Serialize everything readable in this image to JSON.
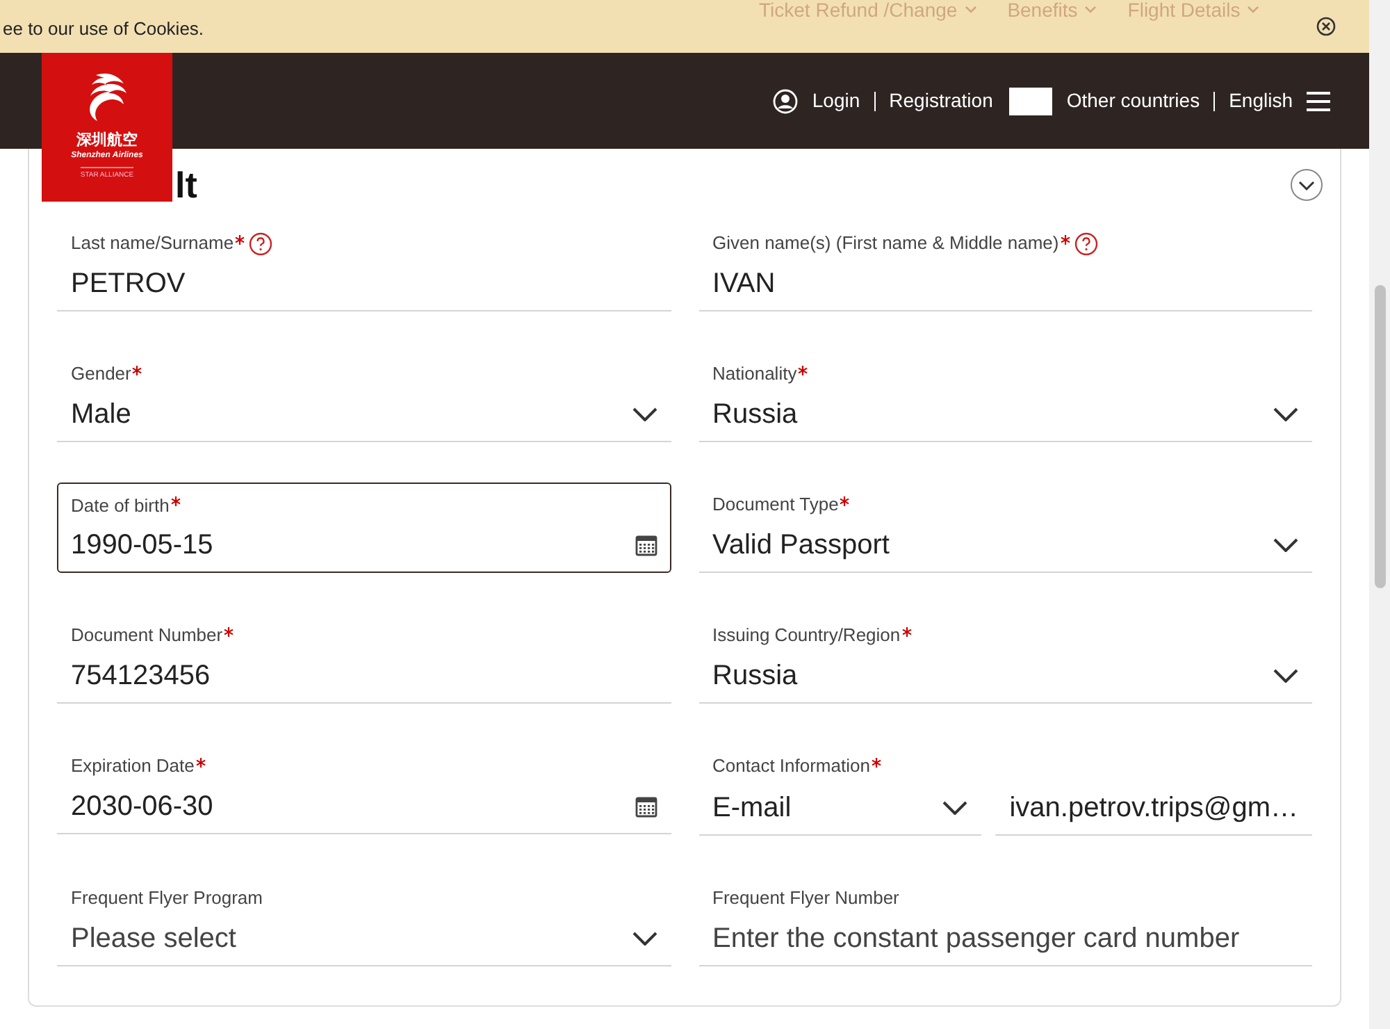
{
  "cookie_bar": {
    "text": "ee to our use of Cookies.",
    "nav": [
      "Ticket Refund /Change",
      "Benefits",
      "Flight Details"
    ]
  },
  "header": {
    "logo": {
      "chinese": "深圳航空",
      "english": "Shenzhen Airlines",
      "alliance": "STAR ALLIANCE"
    },
    "login": "Login",
    "registration": "Registration",
    "country": "Other countries",
    "language": "English"
  },
  "section": {
    "title": "lt",
    "expanded": false
  },
  "fields": [
    {
      "label": "Last name/Surname",
      "required": true,
      "help": true,
      "kind": "text",
      "value": "PETROV",
      "focused": false
    },
    {
      "label": "Given name(s) (First name & Middle name)",
      "required": true,
      "help": true,
      "kind": "text",
      "value": "IVAN",
      "focused": false
    },
    {
      "label": "Gender",
      "required": true,
      "help": false,
      "kind": "select",
      "value": "Male",
      "focused": false
    },
    {
      "label": "Nationality",
      "required": true,
      "help": false,
      "kind": "select",
      "value": "Russia",
      "focused": false
    },
    {
      "label": "Date of birth",
      "required": true,
      "help": false,
      "kind": "date",
      "value": "1990-05-15",
      "focused": true
    },
    {
      "label": "Document Type",
      "required": true,
      "help": false,
      "kind": "select",
      "value": "Valid Passport",
      "focused": false
    },
    {
      "label": "Document Number",
      "required": true,
      "help": false,
      "kind": "text",
      "value": "754123456",
      "focused": false
    },
    {
      "label": "Issuing Country/Region",
      "required": true,
      "help": false,
      "kind": "select",
      "value": "Russia",
      "focused": false
    },
    {
      "label": "Expiration Date",
      "required": true,
      "help": false,
      "kind": "date",
      "value": "2030-06-30",
      "focused": false
    },
    {
      "label": "Contact Information",
      "required": true,
      "help": false,
      "kind": "contact",
      "value": "E-mail",
      "extra": "ivan.petrov.trips@gm…",
      "focused": false
    },
    {
      "label": "Frequent Flyer Program",
      "required": false,
      "help": false,
      "kind": "select",
      "placeholder": "Please select",
      "focused": false
    },
    {
      "label": "Frequent Flyer Number",
      "required": false,
      "help": false,
      "kind": "text",
      "placeholder": "Enter the constant passenger card number",
      "focused": false
    }
  ]
}
